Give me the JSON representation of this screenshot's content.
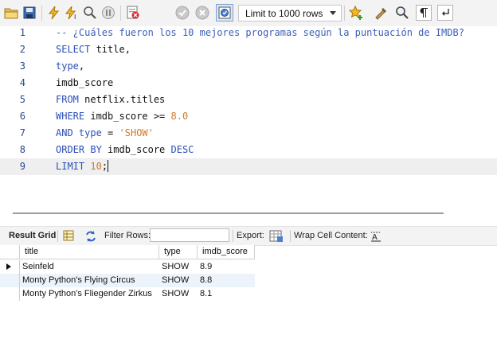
{
  "toolbar": {
    "limit_select_value": "Limit to 1000 rows",
    "icons": [
      "open-folder-icon",
      "save-icon",
      "execute-icon",
      "execute-current-icon",
      "explain-icon",
      "stop-icon",
      "toggle-error-icon",
      "commit-icon",
      "rollback-icon",
      "autocommit-icon",
      "bookmark-star-icon",
      "beautify-icon",
      "find-icon",
      "invisible-chars-icon",
      "wrap-icon"
    ]
  },
  "editor": {
    "lines": [
      {
        "num": "1",
        "code": [
          {
            "t": "-- ¿Cuáles fueron los 10 mejores programas según la puntuación de IMDB?",
            "c": "cm"
          }
        ]
      },
      {
        "num": "2",
        "code": [
          {
            "t": "SELECT",
            "c": "kw"
          },
          {
            "t": " title,",
            "c": ""
          }
        ]
      },
      {
        "num": "3",
        "code": [
          {
            "t": "type",
            "c": "kw"
          },
          {
            "t": ",",
            "c": ""
          }
        ]
      },
      {
        "num": "4",
        "code": [
          {
            "t": "imdb_score",
            "c": ""
          }
        ]
      },
      {
        "num": "5",
        "code": [
          {
            "t": "FROM",
            "c": "kw"
          },
          {
            "t": " netflix.titles",
            "c": ""
          }
        ]
      },
      {
        "num": "6",
        "code": [
          {
            "t": "WHERE",
            "c": "kw"
          },
          {
            "t": " imdb_score >= ",
            "c": ""
          },
          {
            "t": "8.0",
            "c": "num"
          }
        ]
      },
      {
        "num": "7",
        "code": [
          {
            "t": "AND",
            "c": "kw"
          },
          {
            "t": " ",
            "c": ""
          },
          {
            "t": "type",
            "c": "kw"
          },
          {
            "t": " = ",
            "c": ""
          },
          {
            "t": "'SHOW'",
            "c": "str"
          }
        ]
      },
      {
        "num": "8",
        "code": [
          {
            "t": "ORDER BY",
            "c": "kw"
          },
          {
            "t": " imdb_score ",
            "c": ""
          },
          {
            "t": "DESC",
            "c": "kw"
          }
        ]
      },
      {
        "num": "9",
        "code": [
          {
            "t": "LIMIT",
            "c": "kw"
          },
          {
            "t": " ",
            "c": ""
          },
          {
            "t": "10",
            "c": "num"
          },
          {
            "t": ";",
            "c": ""
          }
        ]
      }
    ],
    "current_line": 9
  },
  "result_toolbar": {
    "result_grid_label": "Result Grid",
    "filter_rows_label": "Filter Rows:",
    "filter_value": "",
    "export_label": "Export:",
    "wrap_cell_label": "Wrap Cell Content:"
  },
  "grid": {
    "columns": [
      "title",
      "type",
      "imdb_score"
    ],
    "rows": [
      [
        "Seinfeld",
        "SHOW",
        "8.9"
      ],
      [
        "Monty Python's Flying Circus",
        "SHOW",
        "8.8"
      ],
      [
        "Monty Python's Fliegender Zirkus",
        "SHOW",
        "8.1"
      ]
    ]
  },
  "colors": {
    "keyword": "#2c4fb6",
    "comment": "#3b5fb8",
    "number": "#d07a28",
    "line_number": "#2a4b8c"
  }
}
